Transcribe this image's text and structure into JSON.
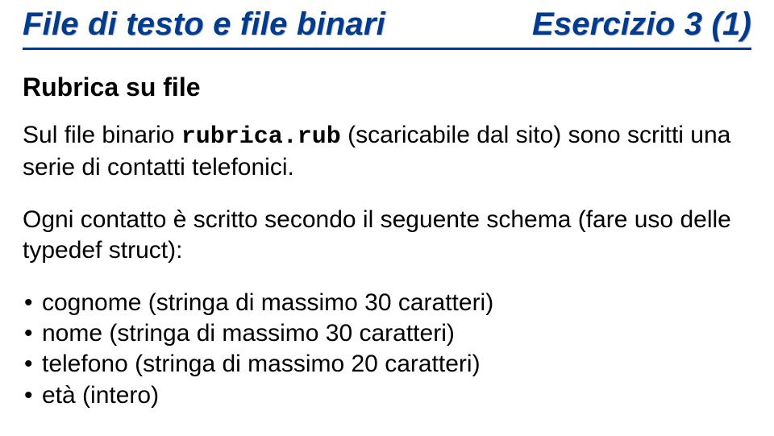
{
  "header": {
    "left": "File di testo e file binari",
    "right": "Esercizio 3 (1)"
  },
  "subtitle": "Rubrica su file",
  "paragraph1_prefix": "Sul file binario ",
  "paragraph1_code": "rubrica.rub",
  "paragraph1_suffix": " (scaricabile dal sito) sono scritti una serie di contatti telefonici.",
  "paragraph2": "Ogni contatto è scritto secondo il seguente schema (fare uso delle typedef struct):",
  "bullets": [
    "cognome (stringa di massimo 30 caratteri)",
    "nome (stringa di massimo 30 caratteri)",
    "telefono (stringa di massimo 20 caratteri)",
    "età (intero)"
  ]
}
